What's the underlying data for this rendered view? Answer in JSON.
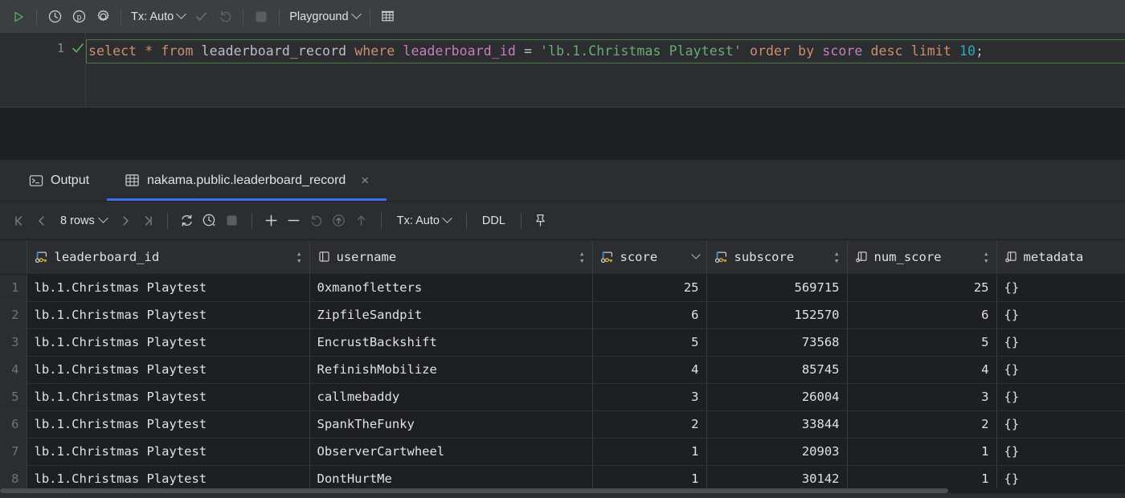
{
  "toolbar": {
    "run_label": "run-query",
    "history_label": "history",
    "profile_label": "profiler",
    "settings_label": "settings",
    "tx_label": "Tx: Auto",
    "commit_label": "commit",
    "rollback_label": "rollback",
    "stop_label": "stop",
    "datasource_label": "Playground",
    "grid_toggle_label": "toggle-grid"
  },
  "editor": {
    "line_number": "1",
    "query_tokens": [
      {
        "t": "select",
        "c": "kw"
      },
      {
        "t": " ",
        "c": "op"
      },
      {
        "t": "*",
        "c": "kw"
      },
      {
        "t": " ",
        "c": "op"
      },
      {
        "t": "from",
        "c": "kw"
      },
      {
        "t": " ",
        "c": "op"
      },
      {
        "t": "leaderboard_record",
        "c": "id"
      },
      {
        "t": " ",
        "c": "op"
      },
      {
        "t": "where",
        "c": "kw"
      },
      {
        "t": " ",
        "c": "op"
      },
      {
        "t": "leaderboard_id",
        "c": "col"
      },
      {
        "t": " ",
        "c": "op"
      },
      {
        "t": "=",
        "c": "op"
      },
      {
        "t": " ",
        "c": "op"
      },
      {
        "t": "'lb.1.Christmas Playtest'",
        "c": "str"
      },
      {
        "t": " ",
        "c": "op"
      },
      {
        "t": "order",
        "c": "kw"
      },
      {
        "t": " ",
        "c": "op"
      },
      {
        "t": "by",
        "c": "kw"
      },
      {
        "t": " ",
        "c": "op"
      },
      {
        "t": "score",
        "c": "col"
      },
      {
        "t": " ",
        "c": "op"
      },
      {
        "t": "desc",
        "c": "kw"
      },
      {
        "t": " ",
        "c": "op"
      },
      {
        "t": "limit",
        "c": "kw"
      },
      {
        "t": " ",
        "c": "op"
      },
      {
        "t": "10",
        "c": "num"
      },
      {
        "t": ";",
        "c": "op"
      }
    ],
    "query_text": "select * from leaderboard_record where leaderboard_id = 'lb.1.Christmas Playtest' order by score desc limit 10;"
  },
  "tabs": [
    {
      "label": "Output",
      "icon": "console-icon",
      "active": false
    },
    {
      "label": "nakama.public.leaderboard_record",
      "icon": "table-icon",
      "active": true,
      "close": "×"
    }
  ],
  "gridbar": {
    "first_page": "first-page",
    "prev_page": "previous-page",
    "rows_label": "8 rows",
    "next_page": "next-page",
    "last_page": "last-page",
    "reload": "reload",
    "page_time": "page-timing",
    "stop": "stop",
    "add_row": "+",
    "delete_row": "−",
    "revert": "revert",
    "submit": "submit",
    "upload": "upload",
    "tx_label": "Tx: Auto",
    "ddl_label": "DDL",
    "pin_label": "pin-tab"
  },
  "table": {
    "columns": [
      {
        "name": "leaderboard_id",
        "icon": "primary-key-column-icon",
        "sort": "both",
        "align": "left"
      },
      {
        "name": "username",
        "icon": "column-icon",
        "sort": "both",
        "align": "left"
      },
      {
        "name": "score",
        "icon": "primary-key-column-icon",
        "sort": "desc",
        "align": "right"
      },
      {
        "name": "subscore",
        "icon": "primary-key-column-icon",
        "sort": "both",
        "align": "right"
      },
      {
        "name": "num_score",
        "icon": "column-icon",
        "sort": "both",
        "align": "right"
      },
      {
        "name": "metadata",
        "icon": "column-icon",
        "sort": "none",
        "align": "left"
      }
    ],
    "rows": [
      {
        "n": "1",
        "leaderboard_id": "lb.1.Christmas Playtest",
        "username": "0xmanofletters",
        "score": "25",
        "subscore": "569715",
        "num_score": "25",
        "metadata": "{}"
      },
      {
        "n": "2",
        "leaderboard_id": "lb.1.Christmas Playtest",
        "username": "ZipfileSandpit",
        "score": "6",
        "subscore": "152570",
        "num_score": "6",
        "metadata": "{}"
      },
      {
        "n": "3",
        "leaderboard_id": "lb.1.Christmas Playtest",
        "username": "EncrustBackshift",
        "score": "5",
        "subscore": "73568",
        "num_score": "5",
        "metadata": "{}"
      },
      {
        "n": "4",
        "leaderboard_id": "lb.1.Christmas Playtest",
        "username": "RefinishMobilize",
        "score": "4",
        "subscore": "85745",
        "num_score": "4",
        "metadata": "{}"
      },
      {
        "n": "5",
        "leaderboard_id": "lb.1.Christmas Playtest",
        "username": "callmebaddy",
        "score": "3",
        "subscore": "26004",
        "num_score": "3",
        "metadata": "{}"
      },
      {
        "n": "6",
        "leaderboard_id": "lb.1.Christmas Playtest",
        "username": "SpankTheFunky",
        "score": "2",
        "subscore": "33844",
        "num_score": "2",
        "metadata": "{}"
      },
      {
        "n": "7",
        "leaderboard_id": "lb.1.Christmas Playtest",
        "username": "ObserverCartwheel",
        "score": "1",
        "subscore": "20903",
        "num_score": "1",
        "metadata": "{}"
      },
      {
        "n": "8",
        "leaderboard_id": "lb.1.Christmas Playtest",
        "username": "DontHurtMe",
        "score": "1",
        "subscore": "30142",
        "num_score": "1",
        "metadata": "{}"
      }
    ]
  },
  "colors": {
    "accent_blue": "#3574f0",
    "run_green": "#499c54",
    "toolbar_bg": "#3c3f41",
    "panel_bg": "#2b2d30",
    "grid_bg": "#1e1f22",
    "text": "#dfe1e5",
    "string_green": "#6aab73",
    "keyword_orange": "#cf8e6d",
    "column_purple": "#c77dbb",
    "number_teal": "#2aacb8"
  }
}
